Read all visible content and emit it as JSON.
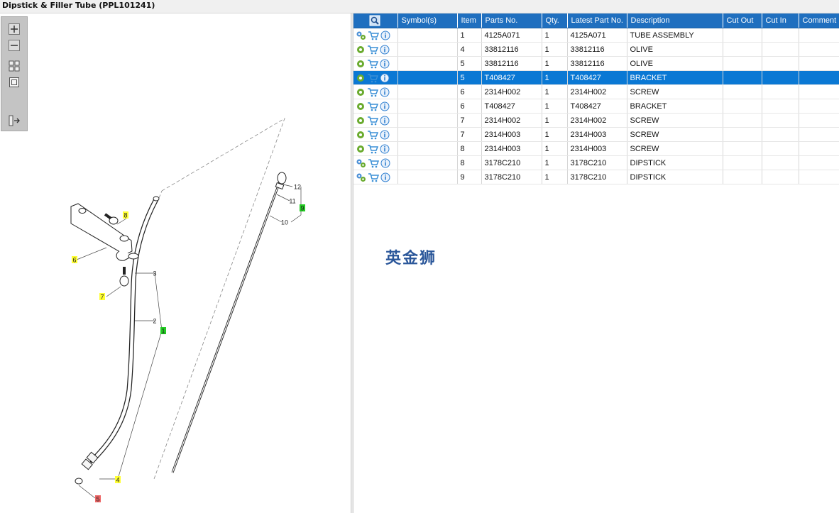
{
  "window": {
    "title": "Dipstick & Filler Tube (PPL101241)"
  },
  "toolbar": {
    "buttons": [
      "zoom-in-icon",
      "zoom-out-icon",
      "fit-all-icon",
      "fit-window-icon",
      "panel-toggle-icon"
    ]
  },
  "diagram": {
    "callouts": [
      {
        "label": "1",
        "highlight": "#22cc22"
      },
      {
        "label": "2",
        "highlight": "none"
      },
      {
        "label": "3",
        "highlight": "none"
      },
      {
        "label": "4",
        "highlight": "#ffff33"
      },
      {
        "label": "5",
        "highlight": "#ee6666"
      },
      {
        "label": "6",
        "highlight": "#ffff33"
      },
      {
        "label": "7",
        "highlight": "#ffff33"
      },
      {
        "label": "8",
        "highlight": "#ffff33"
      },
      {
        "label": "9",
        "highlight": "#22cc22"
      },
      {
        "label": "10",
        "highlight": "none"
      },
      {
        "label": "11",
        "highlight": "none"
      },
      {
        "label": "12",
        "highlight": "none"
      }
    ]
  },
  "table": {
    "columns": [
      "",
      "Symbol(s)",
      "Item",
      "Parts No.",
      "Qty.",
      "Latest Part No.",
      "Description",
      "Cut Out",
      "Cut In",
      "Comment"
    ],
    "selected_row": 3,
    "rows": [
      {
        "settings_icon": "gears-icon",
        "item": "1",
        "part_no": "4125A071",
        "qty": "1",
        "latest": "4125A071",
        "description": "TUBE ASSEMBLY"
      },
      {
        "settings_icon": "gear-icon",
        "item": "4",
        "part_no": "33812116",
        "qty": "1",
        "latest": "33812116",
        "description": "OLIVE"
      },
      {
        "settings_icon": "gear-icon",
        "item": "5",
        "part_no": "33812116",
        "qty": "1",
        "latest": "33812116",
        "description": "OLIVE"
      },
      {
        "settings_icon": "gear-icon",
        "item": "5",
        "part_no": "T408427",
        "qty": "1",
        "latest": "T408427",
        "description": "BRACKET"
      },
      {
        "settings_icon": "gear-icon",
        "item": "6",
        "part_no": "2314H002",
        "qty": "1",
        "latest": "2314H002",
        "description": "SCREW"
      },
      {
        "settings_icon": "gear-icon",
        "item": "6",
        "part_no": "T408427",
        "qty": "1",
        "latest": "T408427",
        "description": "BRACKET"
      },
      {
        "settings_icon": "gear-icon",
        "item": "7",
        "part_no": "2314H002",
        "qty": "1",
        "latest": "2314H002",
        "description": "SCREW"
      },
      {
        "settings_icon": "gear-icon",
        "item": "7",
        "part_no": "2314H003",
        "qty": "1",
        "latest": "2314H003",
        "description": "SCREW"
      },
      {
        "settings_icon": "gear-icon",
        "item": "8",
        "part_no": "2314H003",
        "qty": "1",
        "latest": "2314H003",
        "description": "SCREW"
      },
      {
        "settings_icon": "gears-icon",
        "item": "8",
        "part_no": "3178C210",
        "qty": "1",
        "latest": "3178C210",
        "description": "DIPSTICK"
      },
      {
        "settings_icon": "gears-icon",
        "item": "9",
        "part_no": "3178C210",
        "qty": "1",
        "latest": "3178C210",
        "description": "DIPSTICK"
      }
    ]
  },
  "watermark": {
    "text": "英金狮"
  },
  "colors": {
    "header": "#1f6fbf",
    "selected": "#0a78d4",
    "gear": "#6aab2e",
    "cart": "#3a8fd6",
    "info": "#2f7fd0"
  }
}
